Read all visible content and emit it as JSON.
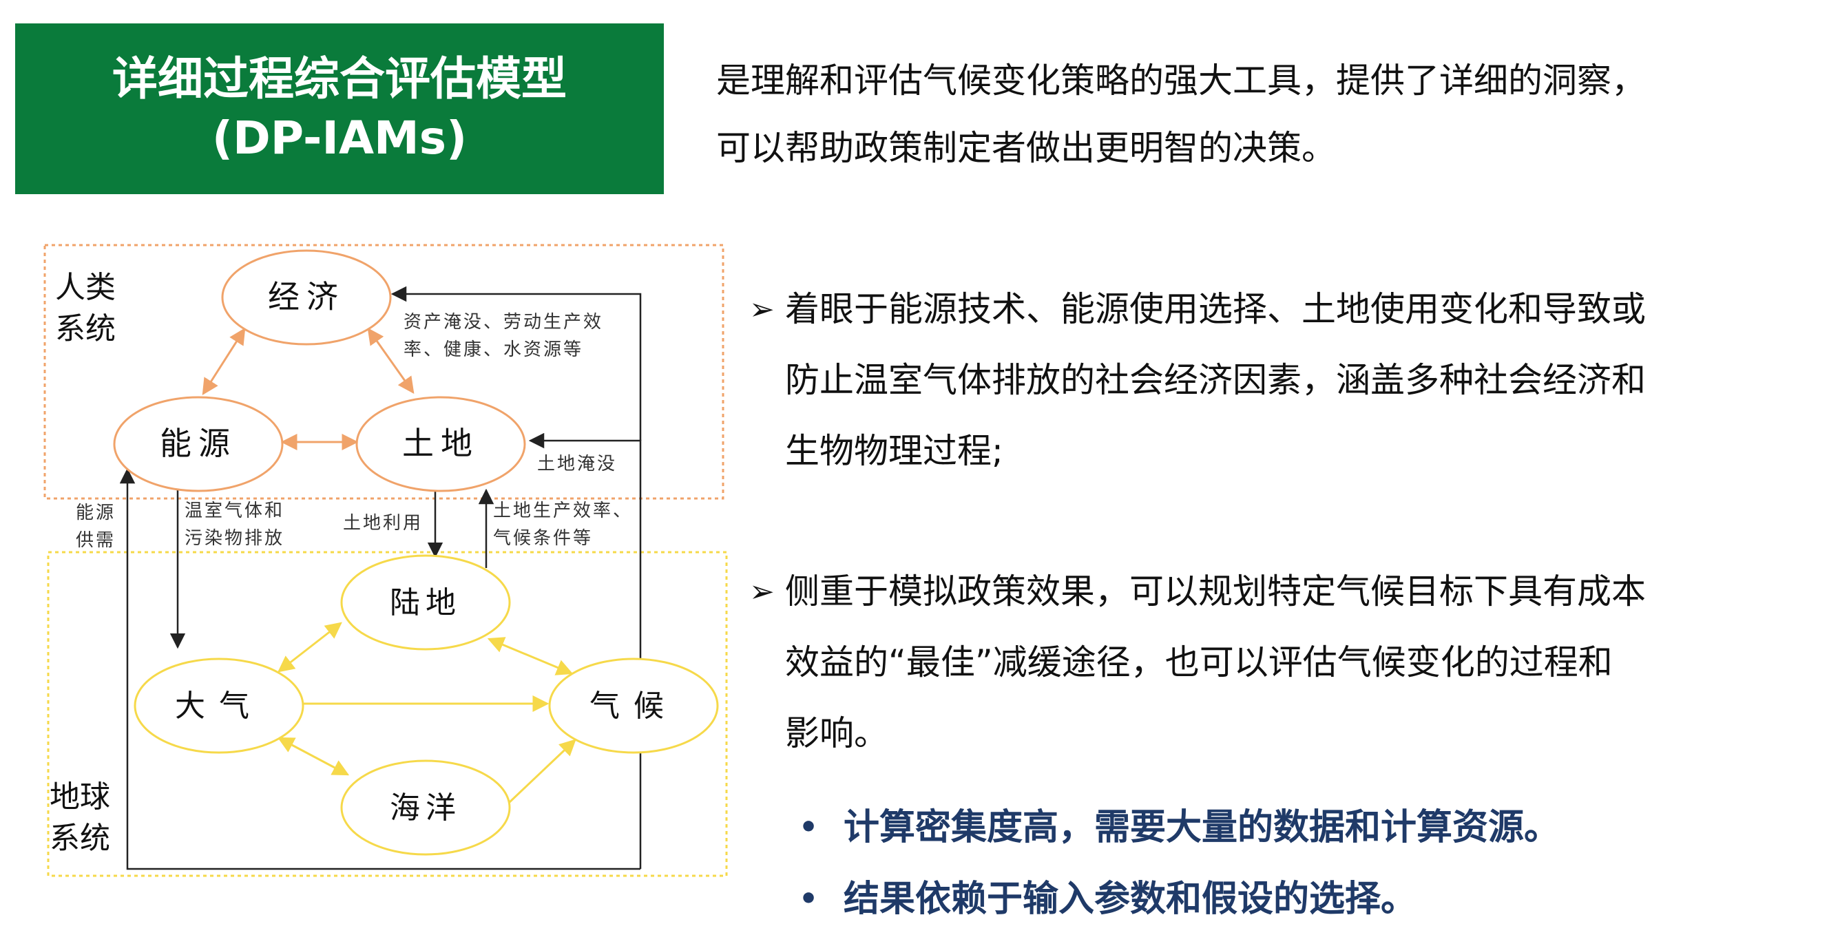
{
  "title": {
    "line1": "详细过程综合评估模型",
    "line2": "(DP-IAMs)"
  },
  "intro": {
    "line1": "是理解和评估气候变化策略的强大工具，提供了详细的洞察，",
    "line2": "可以帮助政策制定者做出更明智的决策。"
  },
  "diagram": {
    "human_system_label": [
      "人类",
      "系统"
    ],
    "earth_system_label": [
      "地球",
      "系统"
    ],
    "nodes": {
      "economy": "经济",
      "energy": "能源",
      "land": "土地",
      "land_surface": "陆地",
      "atmosphere": "大气",
      "climate": "气候",
      "ocean": "海洋"
    },
    "annotations": {
      "asset_loss": [
        "资产淹没、劳动生产效",
        "率、健康、水资源等"
      ],
      "land_flooding": "土地淹没",
      "energy_supply": [
        "能源",
        "供需"
      ],
      "ghg_emissions": [
        "温室气体和",
        "污染物排放"
      ],
      "land_use": "土地利用",
      "land_productivity": [
        "土地生产效率、",
        "气候条件等"
      ]
    },
    "colors": {
      "human": "#f0a36a",
      "earth": "#f6d94a",
      "arrow": "#222222"
    }
  },
  "bullets": [
    {
      "marker": "➢",
      "lines": [
        "着眼于能源技术、能源使用选择、土地使用变化和导致或",
        "防止温室气体排放的社会经济因素，涵盖多种社会经济和",
        "生物物理过程;"
      ]
    },
    {
      "marker": "➢",
      "lines": [
        "侧重于模拟政策效果，可以规划特定气候目标下具有成本",
        "效益的“最佳”减缓途径，也可以评估气候变化的过程和",
        "影响。"
      ]
    }
  ],
  "dot_items": [
    {
      "marker": "•",
      "text": "计算密集度高，需要大量的数据和计算资源。"
    },
    {
      "marker": "•",
      "text": "结果依赖于输入参数和假设的选择。"
    }
  ]
}
